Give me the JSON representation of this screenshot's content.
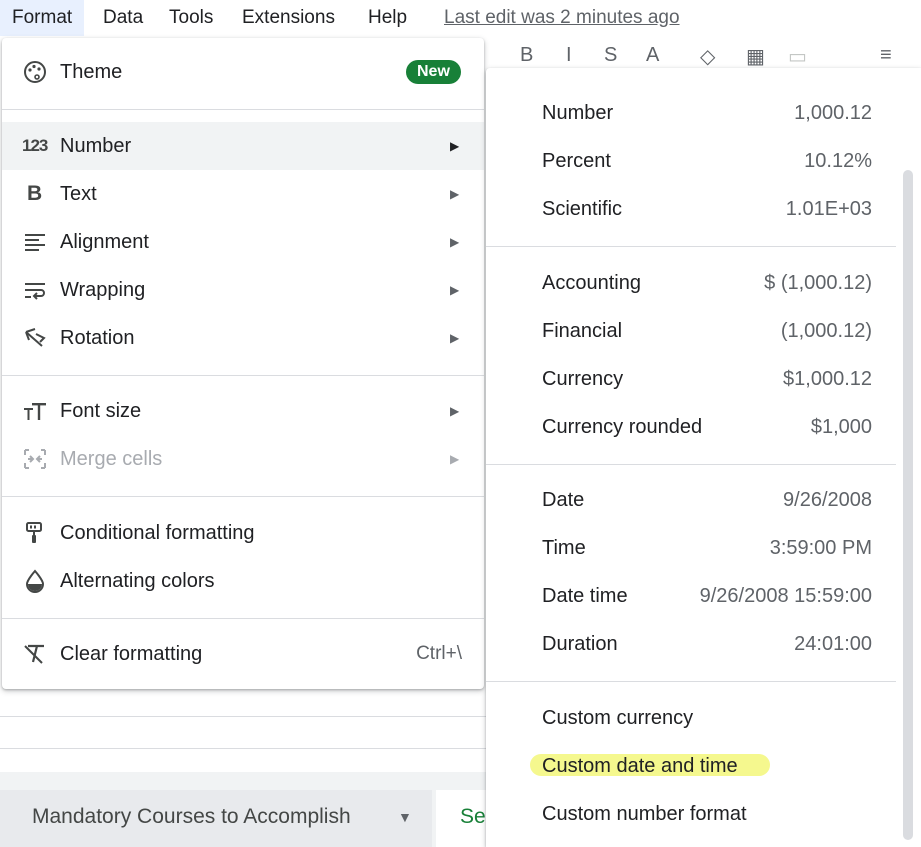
{
  "menubar": {
    "items": [
      "Format",
      "Data",
      "Tools",
      "Extensions",
      "Help"
    ],
    "last_edit": "Last edit was 2 minutes ago"
  },
  "format_menu": {
    "theme": {
      "label": "Theme",
      "badge": "New",
      "icon": "palette-icon"
    },
    "number": {
      "label": "Number",
      "icon": "number-format-icon"
    },
    "text": {
      "label": "Text",
      "icon": "bold-icon"
    },
    "alignment": {
      "label": "Alignment",
      "icon": "align-left-icon"
    },
    "wrapping": {
      "label": "Wrapping",
      "icon": "text-wrap-icon"
    },
    "rotation": {
      "label": "Rotation",
      "icon": "text-rotation-icon"
    },
    "font_size": {
      "label": "Font size",
      "icon": "font-size-icon"
    },
    "merge_cells": {
      "label": "Merge cells",
      "icon": "merge-cells-icon"
    },
    "conditional_formatting": {
      "label": "Conditional formatting",
      "icon": "paint-roller-icon"
    },
    "alternating_colors": {
      "label": "Alternating colors",
      "icon": "droplet-icon"
    },
    "clear_formatting": {
      "label": "Clear formatting",
      "shortcut": "Ctrl+\\",
      "icon": "clear-format-icon"
    }
  },
  "number_submenu": {
    "group1": [
      {
        "label": "Number",
        "value": "1,000.12"
      },
      {
        "label": "Percent",
        "value": "10.12%"
      },
      {
        "label": "Scientific",
        "value": "1.01E+03"
      }
    ],
    "group2": [
      {
        "label": "Accounting",
        "value": "$ (1,000.12)"
      },
      {
        "label": "Financial",
        "value": "(1,000.12)"
      },
      {
        "label": "Currency",
        "value": "$1,000.12"
      },
      {
        "label": "Currency rounded",
        "value": "$1,000"
      }
    ],
    "group3": [
      {
        "label": "Date",
        "value": "9/26/2008"
      },
      {
        "label": "Time",
        "value": "3:59:00 PM"
      },
      {
        "label": "Date time",
        "value": "9/26/2008 15:59:00"
      },
      {
        "label": "Duration",
        "value": "24:01:00"
      }
    ],
    "group4": [
      {
        "label": "Custom currency"
      },
      {
        "label": "Custom date and time"
      },
      {
        "label": "Custom number format"
      }
    ]
  },
  "sheet_tabs": {
    "active": "Mandatory Courses to Accomplish",
    "next": "Se"
  },
  "colors": {
    "badge": "#188038",
    "hover": "#f1f3f4",
    "highlight": "#f3f77a"
  }
}
